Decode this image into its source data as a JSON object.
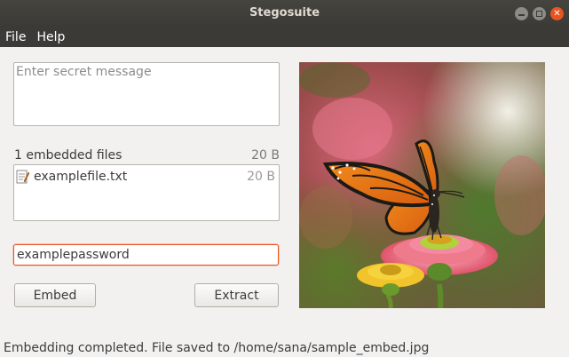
{
  "window": {
    "title": "Stegosuite",
    "buttons": {
      "minimize_icon": "minimize-icon",
      "maximize_icon": "maximize-icon",
      "close_icon": "close-icon"
    }
  },
  "menu": [
    {
      "label": "File"
    },
    {
      "label": "Help"
    }
  ],
  "message": {
    "placeholder": "Enter secret message",
    "value": ""
  },
  "files": {
    "count_label": "1 embedded files",
    "total_size": "20 B",
    "items": [
      {
        "name": "examplefile.txt",
        "size": "20 B",
        "icon": "text-file-icon"
      }
    ]
  },
  "password": {
    "value": "examplepassword"
  },
  "actions": {
    "embed_label": "Embed",
    "extract_label": "Extract"
  },
  "status": {
    "text": "Embedding completed. File saved to /home/sana/sample_embed.jpg"
  },
  "colors": {
    "accent": "#e95420",
    "titlebar": "#3b3a36",
    "window_bg": "#f2f1f0"
  }
}
